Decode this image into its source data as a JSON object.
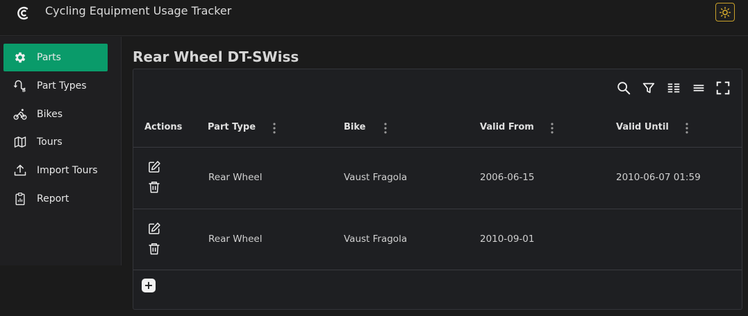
{
  "app": {
    "title": "Cycling Equipment Usage Tracker"
  },
  "sidebar": {
    "items": [
      {
        "label": "Parts",
        "icon": "gear-icon",
        "active": true
      },
      {
        "label": "Part Types",
        "icon": "route-ab-icon",
        "active": false
      },
      {
        "label": "Bikes",
        "icon": "bicycle-icon",
        "active": false
      },
      {
        "label": "Tours",
        "icon": "map-icon",
        "active": false
      },
      {
        "label": "Import Tours",
        "icon": "upload-icon",
        "active": false
      },
      {
        "label": "Report",
        "icon": "clipboard-icon",
        "active": false
      }
    ]
  },
  "page": {
    "title": "Rear Wheel DT-SWiss"
  },
  "table": {
    "columns": [
      "Actions",
      "Part Type",
      "Bike",
      "Valid From",
      "Valid Until"
    ],
    "rows": [
      {
        "part_type": "Rear Wheel",
        "bike": "Vaust Fragola",
        "valid_from": "2006-06-15",
        "valid_until": "2010-06-07 01:59"
      },
      {
        "part_type": "Rear Wheel",
        "bike": "Vaust Fragola",
        "valid_from": "2010-09-01",
        "valid_until": ""
      }
    ],
    "toolbar_icons": [
      "search-icon",
      "filter-icon",
      "columns-icon",
      "density-icon",
      "fullscreen-icon"
    ],
    "add_label": "+"
  },
  "colors": {
    "accent": "#0a9b6a",
    "background": "#1b1b1b",
    "panel": "#1e1f22",
    "theme_border": "#c8a02a"
  }
}
